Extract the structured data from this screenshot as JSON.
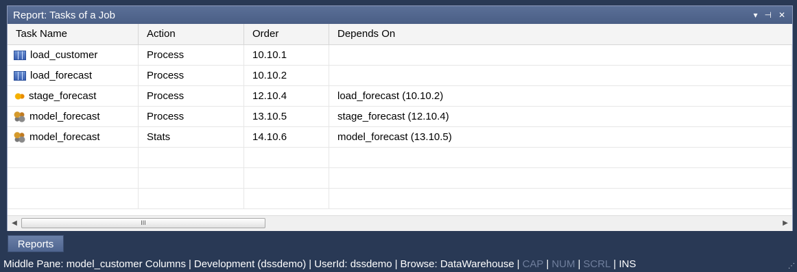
{
  "panel": {
    "title": "Report: Tasks of a Job",
    "controls": {
      "dropdown": "▾",
      "pin": "⊣",
      "close": "✕"
    }
  },
  "grid": {
    "columns": [
      "Task Name",
      "Action",
      "Order",
      "Depends On"
    ],
    "rows": [
      {
        "icon": "table-icon",
        "task": "load_customer",
        "action": "Process",
        "order": "10.10.1",
        "depends": ""
      },
      {
        "icon": "table-icon",
        "task": "load_forecast",
        "action": "Process",
        "order": "10.10.2",
        "depends": ""
      },
      {
        "icon": "stage-icon",
        "task": "stage_forecast",
        "action": "Process",
        "order": "12.10.4",
        "depends": "load_forecast (10.10.2)"
      },
      {
        "icon": "model-icon",
        "task": "model_forecast",
        "action": "Process",
        "order": "13.10.5",
        "depends": "stage_forecast (12.10.4)"
      },
      {
        "icon": "model-icon",
        "task": "model_forecast",
        "action": "Stats",
        "order": "14.10.6",
        "depends": "model_forecast (13.10.5)"
      }
    ]
  },
  "scrollbar": {
    "left_arrow": "◀",
    "right_arrow": "▶",
    "thumb_grip": "III"
  },
  "tabs": {
    "reports": "Reports"
  },
  "status": {
    "middle_pane": "Middle Pane: model_customer Columns",
    "connection": "Development (dssdemo)",
    "user": "UserId: dssdemo",
    "browse": "Browse: DataWarehouse",
    "cap": "CAP",
    "num": "NUM",
    "scrl": "SCRL",
    "ins": "INS"
  },
  "colors": {
    "frame": "#293955",
    "title_bar": "#4f6590",
    "status_dim": "#6f7e9c"
  }
}
